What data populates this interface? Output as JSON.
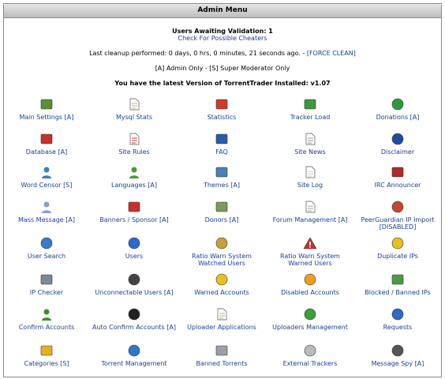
{
  "header": {
    "title": "Admin Menu"
  },
  "info": {
    "awaiting": "Users Awaiting Validation: 1",
    "cheaters": "Check For Possible Cheaters",
    "cleanup_text": "Last cleanup performed: 0 days, 0 hrs, 0 minutes, 21 seconds ago. - ",
    "force_clean": "[FORCE CLEAN]",
    "legend": "[A] Admin Only - [S] Super Moderator Only",
    "version": "You have the latest Version of TorrentTrader Installed: v1.07"
  },
  "items": [
    {
      "label": "Main Settings [A]",
      "icon": "settings-icon",
      "color": "#5a8f3a"
    },
    {
      "label": "Mysql Stats",
      "icon": "mysql-stats-icon",
      "color": "#c9b37a"
    },
    {
      "label": "Statistics",
      "icon": "statistics-icon",
      "color": "#d03a2c"
    },
    {
      "label": "Tracker Load",
      "icon": "tracker-load-icon",
      "color": "#3a9a3a"
    },
    {
      "label": "Donations [A]",
      "icon": "donations-icon",
      "color": "#2e9a3c"
    },
    {
      "label": "Database [A]",
      "icon": "database-icon",
      "color": "#c8302c"
    },
    {
      "label": "Site Rules",
      "icon": "site-rules-icon",
      "color": "#d23b3b"
    },
    {
      "label": "FAQ",
      "icon": "faq-icon",
      "color": "#2b5aa8"
    },
    {
      "label": "Site News",
      "icon": "site-news-icon",
      "color": "#9a9a9a"
    },
    {
      "label": "Disclaimer",
      "icon": "disclaimer-icon",
      "color": "#234a9a"
    },
    {
      "label": "Word Censor [S]",
      "icon": "word-censor-icon",
      "color": "#3a7fc0"
    },
    {
      "label": "Languages [A]",
      "icon": "languages-icon",
      "color": "#4a9a3a"
    },
    {
      "label": "Themes [A]",
      "icon": "themes-icon",
      "color": "#4a7fb8"
    },
    {
      "label": "Site Log",
      "icon": "site-log-icon",
      "color": "#cfcfcf"
    },
    {
      "label": "IRC Announcer",
      "icon": "irc-icon",
      "color": "#b02a2a"
    },
    {
      "label": "Mass Message [A]",
      "icon": "mass-message-icon",
      "color": "#8aa0c8"
    },
    {
      "label": "Banners / Sponsor [A]",
      "icon": "banners-icon",
      "color": "#c8302c"
    },
    {
      "label": "Donors [A]",
      "icon": "donors-icon",
      "color": "#7a9a5a"
    },
    {
      "label": "Forum Management [A]",
      "icon": "forum-icon",
      "color": "#aaaaaa"
    },
    {
      "label": "PeerGuardian IP Import [DISABLED]",
      "icon": "peerguardian-icon",
      "color": "#c04a2a"
    },
    {
      "label": "User Search",
      "icon": "search-icon",
      "color": "#3a7ac8"
    },
    {
      "label": "Users",
      "icon": "users-icon",
      "color": "#2b6ac8"
    },
    {
      "label": "Ratio Warn System Watched Users",
      "icon": "ratio-watched-icon",
      "color": "#c8a03a"
    },
    {
      "label": "Ratio Warn System Warned Users",
      "icon": "warning-icon",
      "color": "#c8302c"
    },
    {
      "label": "Duplicate IPs",
      "icon": "duplicate-ips-icon",
      "color": "#e8c020"
    },
    {
      "label": "IP Checker",
      "icon": "ip-checker-icon",
      "color": "#7a8a9a"
    },
    {
      "label": "Unconnectable Users [A]",
      "icon": "unconnectable-icon",
      "color": "#444444"
    },
    {
      "label": "Warned Accounts",
      "icon": "warned-accounts-icon",
      "color": "#e8c020"
    },
    {
      "label": "Disabled Accounts",
      "icon": "disabled-accounts-icon",
      "color": "#e8a020"
    },
    {
      "label": "Blocked / Banned IPs",
      "icon": "blocked-ips-icon",
      "color": "#4a9a4a"
    },
    {
      "label": "Confirm Accounts",
      "icon": "confirm-accounts-icon",
      "color": "#3a8a2a"
    },
    {
      "label": "Auto Confirm Accounts [A]",
      "icon": "auto-confirm-icon",
      "color": "#222222"
    },
    {
      "label": "Uploader Applications",
      "icon": "uploader-applications-icon",
      "color": "#9ab87a"
    },
    {
      "label": "Uploaders Management",
      "icon": "uploaders-management-icon",
      "color": "#3aa03a"
    },
    {
      "label": "Requests",
      "icon": "requests-icon",
      "color": "#2b6ac8"
    },
    {
      "label": "Categories [S]",
      "icon": "categories-icon",
      "color": "#e8b020"
    },
    {
      "label": "Torrent Management",
      "icon": "torrent-management-icon",
      "color": "#2b7ac8"
    },
    {
      "label": "Banned Torrents",
      "icon": "banned-torrents-icon",
      "color": "#9aa0a8"
    },
    {
      "label": "External Trackers",
      "icon": "external-trackers-icon",
      "color": "#bbbbbb"
    },
    {
      "label": "Message Spy [A]",
      "icon": "message-spy-icon",
      "color": "#555555"
    }
  ]
}
